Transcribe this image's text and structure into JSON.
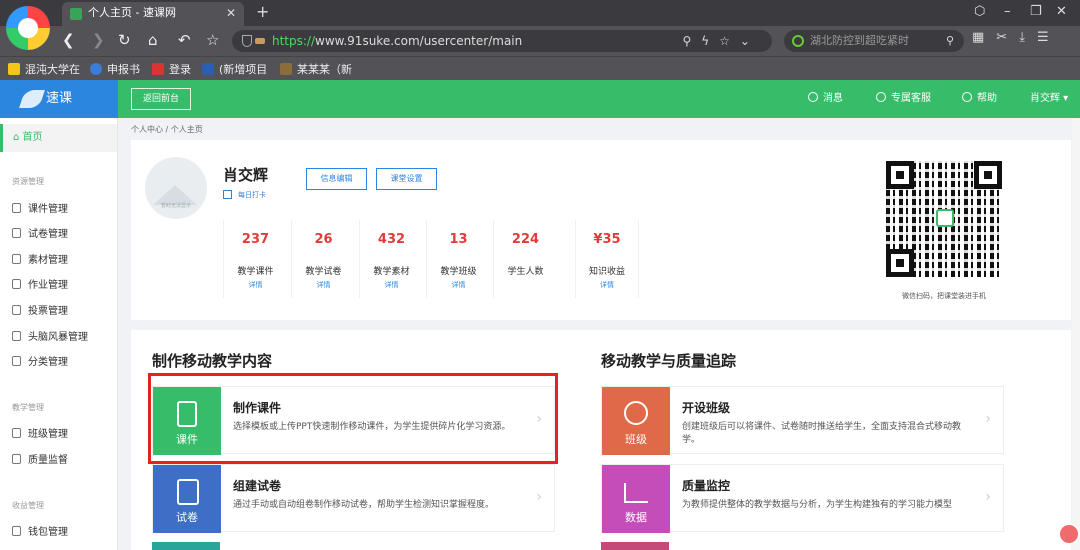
{
  "browser": {
    "tab_title": "个人主页 - 速课网",
    "tab_close": "✕",
    "new_tab": "+",
    "url_scheme": "https://",
    "url_rest": "www.91suke.com/usercenter/main",
    "search_placeholder": "湖北防控到超吃紧时",
    "bookmarks": [
      "混沌大学在",
      "申报书",
      "登录",
      "(新增项目",
      "某某某（新"
    ]
  },
  "app": {
    "logo_text": "速课",
    "back_button": "返回前台",
    "header_items": [
      "消息",
      "专属客服",
      "帮助",
      "肖交辉"
    ]
  },
  "sidebar": {
    "home": "首页",
    "group1": "资源管理",
    "items1": [
      "课件管理",
      "试卷管理",
      "素材管理",
      "作业管理",
      "投票管理",
      "头脑风暴管理",
      "分类管理"
    ],
    "group2": "教学管理",
    "items2": [
      "班级管理",
      "质量监督"
    ],
    "group3": "收益管理",
    "items3": [
      "钱包管理"
    ]
  },
  "breadcrumb": "个人中心 / 个人主页",
  "profile": {
    "name": "肖交辉",
    "checkin": "每日打卡",
    "avatar_text": "暂时无法显示",
    "btn_edit": "信息编辑",
    "btn_settings": "课堂设置",
    "stats": [
      {
        "value": "237",
        "label": "教学课件",
        "link": "详情"
      },
      {
        "value": "26",
        "label": "教学试卷",
        "link": "详情"
      },
      {
        "value": "432",
        "label": "教学素材",
        "link": "详情"
      },
      {
        "value": "13",
        "label": "教学班级",
        "link": "详情"
      },
      {
        "value": "224",
        "label": "学生人数",
        "link": ""
      },
      {
        "value": "¥35",
        "label": "知识收益",
        "link": "详情"
      }
    ],
    "qr_caption": "微信扫码，把课堂装进手机"
  },
  "sections": {
    "left_title": "制作移动教学内容",
    "right_title": "移动教学与质量追踪",
    "left_items": [
      {
        "tile": "课件",
        "title": "制作课件",
        "desc": "选择模板或上传PPT快速制作移动课件，为学生提供碎片化学习资源。",
        "color": "#37bd6a"
      },
      {
        "tile": "试卷",
        "title": "组建试卷",
        "desc": "通过手动或自动组卷制作移动试卷，帮助学生检测知识掌握程度。",
        "color": "#3d6fc6"
      }
    ],
    "right_items": [
      {
        "tile": "班级",
        "title": "开设班级",
        "desc": "创建班级后可以将课件、试卷随时推送给学生，全面支持混合式移动教学。",
        "color": "#e0694a"
      },
      {
        "tile": "数据",
        "title": "质量监控",
        "desc": "为教师提供整体的教学数据与分析，为学生构建独有的学习能力模型",
        "color": "#c44dba"
      }
    ],
    "arrow": "›"
  }
}
